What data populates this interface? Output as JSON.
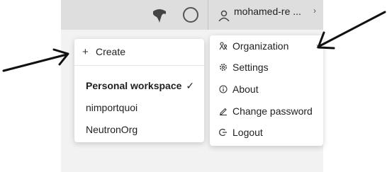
{
  "header": {
    "user_name": "mohamed-re ...",
    "chevron": "›",
    "icons": [
      "globe-icon",
      "help-circle-icon",
      "user-icon",
      "chevron-right-icon"
    ]
  },
  "workspace_menu": {
    "create_label": "Create",
    "create_icon": "plus-icon",
    "items": [
      {
        "label": "Personal workspace",
        "selected": true
      },
      {
        "label": "nimportquoi",
        "selected": false
      },
      {
        "label": "NeutronOrg",
        "selected": false
      }
    ],
    "check_glyph": "✓"
  },
  "account_menu": {
    "items": [
      {
        "label": "Organization",
        "icon": "organization-icon",
        "has_submenu": true
      },
      {
        "label": "Settings",
        "icon": "gear-icon"
      },
      {
        "label": "About",
        "icon": "info-icon"
      },
      {
        "label": "Change password",
        "icon": "pencil-icon"
      },
      {
        "label": "Logout",
        "icon": "logout-icon"
      }
    ],
    "submenu_chevron": "›"
  },
  "colors": {
    "app_background": "#f2f2f2",
    "topbar": "#dedede",
    "panel": "#ffffff",
    "annotation_arrow": "#111111"
  }
}
